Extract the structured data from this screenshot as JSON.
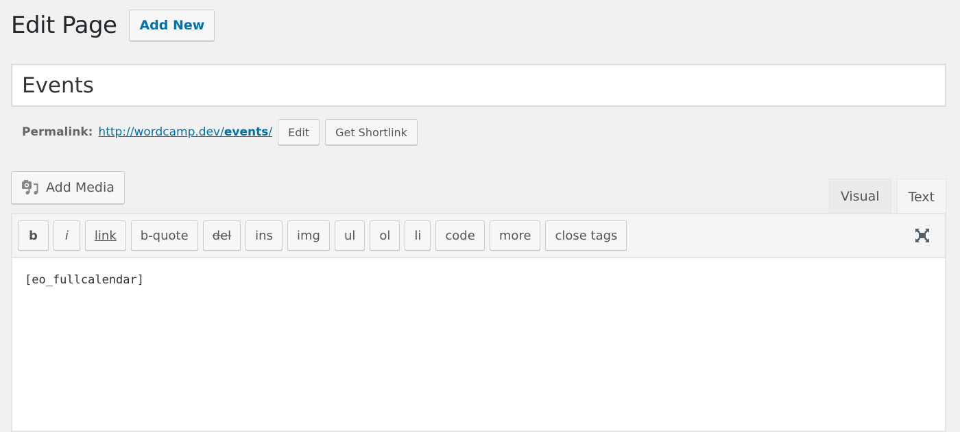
{
  "header": {
    "title": "Edit Page",
    "add_new_label": "Add New"
  },
  "post_title": {
    "value": "Events"
  },
  "permalink": {
    "label": "Permalink:",
    "url_base": "http://wordcamp.dev/",
    "url_slug": "events",
    "url_trailing": "/",
    "edit_label": "Edit",
    "shortlink_label": "Get Shortlink"
  },
  "media": {
    "add_media_label": "Add Media",
    "icon": "add-media-icon"
  },
  "editor_tabs": [
    {
      "label": "Visual",
      "active": false
    },
    {
      "label": "Text",
      "active": true
    }
  ],
  "quicktags": [
    {
      "label": "b",
      "style": "bold"
    },
    {
      "label": "i",
      "style": "italic"
    },
    {
      "label": "link",
      "style": "underline"
    },
    {
      "label": "b-quote",
      "style": "plain"
    },
    {
      "label": "del",
      "style": "strike"
    },
    {
      "label": "ins",
      "style": "plain"
    },
    {
      "label": "img",
      "style": "plain"
    },
    {
      "label": "ul",
      "style": "plain"
    },
    {
      "label": "ol",
      "style": "plain"
    },
    {
      "label": "li",
      "style": "plain"
    },
    {
      "label": "code",
      "style": "plain"
    },
    {
      "label": "more",
      "style": "plain"
    },
    {
      "label": "close tags",
      "style": "plain"
    }
  ],
  "fullscreen_icon": "distraction-free-icon",
  "editor_content": "[eo_fullcalendar]",
  "colors": {
    "link": "#0073aa",
    "background": "#f1f1f1",
    "text": "#23282d"
  }
}
